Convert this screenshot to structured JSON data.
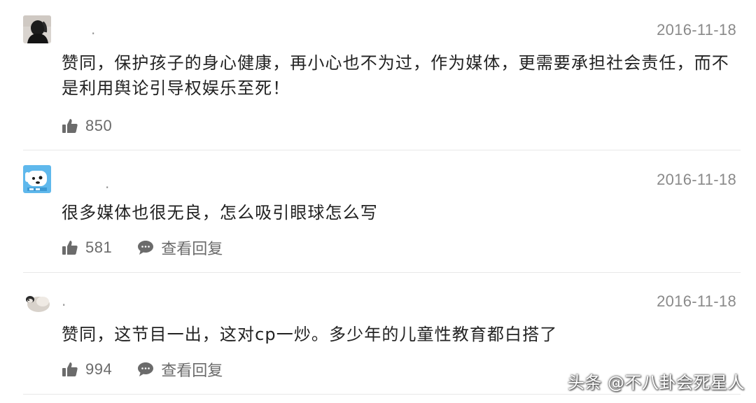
{
  "comments": [
    {
      "username": ".",
      "date": "2016-11-18",
      "text": "赞同，保护孩子的身心健康，再小心也不为过，作为媒体，更需要承担社会责任，而不是利用舆论引导权娱乐至死！",
      "likes": "850",
      "reply_label": ""
    },
    {
      "username": ".",
      "date": "2016-11-18",
      "text": "很多媒体也很无良，怎么吸引眼球怎么写",
      "likes": "581",
      "reply_label": "查看回复"
    },
    {
      "username": ".",
      "date": "2016-11-18",
      "text": "赞同，这节目一出，这对cp一炒。多少年的儿童性教育都白搭了",
      "likes": "994",
      "reply_label": "查看回复"
    }
  ],
  "watermark": "头条 @不八卦会死星人",
  "colors": {
    "date": "#8a8a8a",
    "text": "#222222",
    "action": "#6b6b6b",
    "divider": "#e8e8e8"
  },
  "icons": {
    "like": "thumbs-up-icon",
    "reply": "speech-bubble-icon"
  }
}
